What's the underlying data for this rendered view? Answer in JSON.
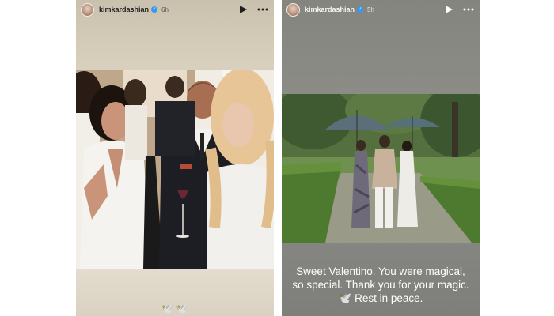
{
  "stories": [
    {
      "username": "kimkardashian",
      "time": "6h",
      "caption": "🕊️ 🕊️"
    },
    {
      "username": "kimkardashian",
      "time": "5h",
      "caption": "Sweet Valentino. You were magical, so special. Thank you for your magic. 🕊️ Rest in peace."
    }
  ],
  "icons": {
    "verified": "verified-badge-icon",
    "play": "play-icon",
    "more": "more-options-icon"
  },
  "colors": {
    "verified": "#3897f0",
    "left_story_bg": "#d8cfbd",
    "right_story_bg": "#878783"
  }
}
